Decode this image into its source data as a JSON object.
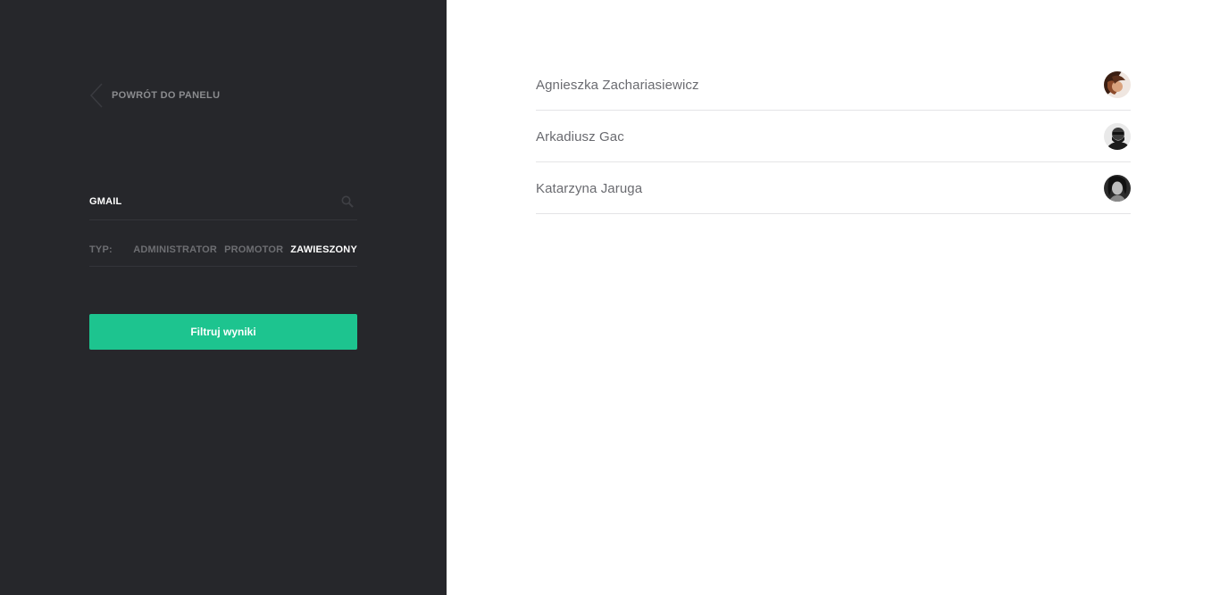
{
  "sidebar": {
    "back_label": "POWRÓT DO PANELU",
    "search": {
      "value": "GMAIL",
      "placeholder": ""
    },
    "type_filter": {
      "label": "TYP:",
      "options": [
        {
          "label": "ADMINISTRATOR",
          "active": false
        },
        {
          "label": "PROMOTOR",
          "active": false
        },
        {
          "label": "ZAWIESZONY",
          "active": true
        }
      ]
    },
    "filter_button_label": "Filtruj wyniki"
  },
  "results": {
    "users": [
      {
        "name": "Agnieszka Zachariasiewicz",
        "avatar": "avatar-photo"
      },
      {
        "name": "Arkadiusz Gac",
        "avatar": "avatar-photo"
      },
      {
        "name": "Katarzyna Jaruga",
        "avatar": "avatar-photo"
      }
    ]
  },
  "colors": {
    "sidebar_bg": "#26272b",
    "accent": "#1dc48f",
    "muted_text": "#6d6e72",
    "active_text": "#ffffff",
    "result_text": "#6a6b70"
  },
  "icons": {
    "back": "chevron-left-icon",
    "search": "search-icon"
  }
}
